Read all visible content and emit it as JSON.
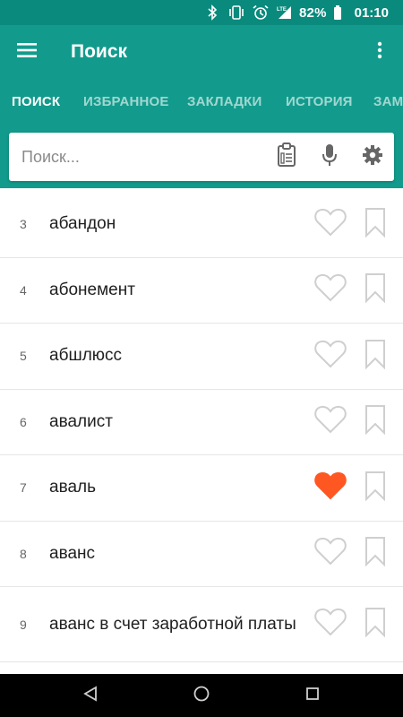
{
  "status_bar": {
    "icons": [
      "bluetooth-icon",
      "vibrate-icon",
      "alarm-icon",
      "lte-signal-icon",
      "battery-icon"
    ],
    "battery": "82%",
    "time": "01:10"
  },
  "app_bar": {
    "title": "Поиск",
    "icons": [
      "menu-icon",
      "more-vert-icon"
    ]
  },
  "tabs": [
    {
      "label": "ПОИСК",
      "active": true
    },
    {
      "label": "ИЗБРАННОЕ",
      "active": false
    },
    {
      "label": "ЗАКЛАДКИ",
      "active": false
    },
    {
      "label": "ИСТОРИЯ",
      "active": false
    },
    {
      "label": "ЗАМ",
      "active": false
    }
  ],
  "search": {
    "placeholder": "Поиск...",
    "value": "",
    "tools": [
      "clipboard-icon",
      "microphone-icon",
      "settings-icon"
    ]
  },
  "words": [
    {
      "num": "3",
      "text": "абандон",
      "favorite": false,
      "bookmarked": false
    },
    {
      "num": "4",
      "text": "абонемент",
      "favorite": false,
      "bookmarked": false
    },
    {
      "num": "5",
      "text": "абшлюсс",
      "favorite": false,
      "bookmarked": false
    },
    {
      "num": "6",
      "text": "авалист",
      "favorite": false,
      "bookmarked": false
    },
    {
      "num": "7",
      "text": "аваль",
      "favorite": true,
      "bookmarked": false
    },
    {
      "num": "8",
      "text": "аванс",
      "favorite": false,
      "bookmarked": false
    },
    {
      "num": "9",
      "text": "аванс в счет заработной платы",
      "favorite": false,
      "bookmarked": false
    }
  ],
  "colors": {
    "primary": "#129b8c",
    "status_bar": "#0a8a7d",
    "favorite_active": "#ff5722",
    "icon_inactive": "#cfcfcf",
    "tool_icon": "#666666"
  },
  "nav_bar": {
    "icons": [
      "back-icon",
      "home-icon",
      "recents-icon"
    ]
  }
}
